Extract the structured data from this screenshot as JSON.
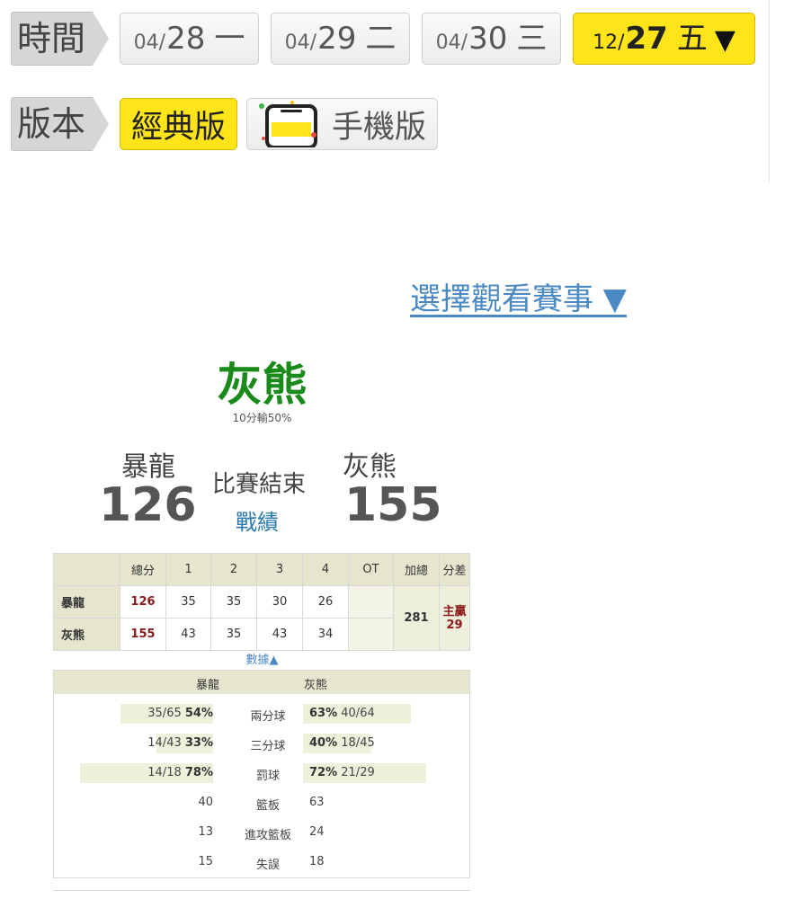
{
  "time_filter": {
    "label": "時間",
    "dates": [
      {
        "md": "04/",
        "d": "28",
        "w": "一",
        "active": false
      },
      {
        "md": "04/",
        "d": "29",
        "w": "二",
        "active": false
      },
      {
        "md": "04/",
        "d": "30",
        "w": "三",
        "active": false
      },
      {
        "md": "12/",
        "d": "27",
        "w": "五",
        "active": true,
        "arrow": "▼"
      }
    ]
  },
  "version_filter": {
    "label": "版本",
    "classic": "經典版",
    "mobile": "手機版"
  },
  "select_game": "選擇觀看賽事 ▼",
  "game": {
    "winner": "灰熊",
    "note": "10分輸50%",
    "away_name": "暴龍",
    "home_name": "灰熊",
    "away_score": "126",
    "home_score": "155",
    "status": "比賽結束",
    "record_link": "戰績"
  },
  "quarter_table": {
    "headers": [
      "",
      "總分",
      "1",
      "2",
      "3",
      "4",
      "OT",
      "加總",
      "分差"
    ],
    "rows": [
      {
        "team": "暴龍",
        "total": "126",
        "q1": "35",
        "q2": "35",
        "q3": "30",
        "q4": "26",
        "ot": ""
      },
      {
        "team": "灰熊",
        "total": "155",
        "q1": "43",
        "q2": "35",
        "q3": "43",
        "q4": "34",
        "ot": ""
      }
    ],
    "sum": "281",
    "diff_label": "主贏",
    "diff_value": "29"
  },
  "data_toggle": "數據▲",
  "stats": {
    "away_header": "暴龍",
    "home_header": "灰熊",
    "rows": [
      {
        "label": "兩分球",
        "away_frac": "35/65",
        "away_pct": "54%",
        "home_pct": "63%",
        "home_frac": "40/64",
        "away_level": 0.54,
        "home_level": 0.63
      },
      {
        "label": "三分球",
        "away_frac": "14/43",
        "away_pct": "33%",
        "home_pct": "40%",
        "home_frac": "18/45",
        "away_level": 0.33,
        "home_level": 0.4
      },
      {
        "label": "罰球",
        "away_frac": "14/18",
        "away_pct": "78%",
        "home_pct": "72%",
        "home_frac": "21/29",
        "away_level": 0.78,
        "home_level": 0.72
      },
      {
        "label": "籃板",
        "away_val": "40",
        "home_val": "63"
      },
      {
        "label": "進攻籃板",
        "away_val": "13",
        "home_val": "24"
      },
      {
        "label": "失誤",
        "away_val": "15",
        "home_val": "18"
      }
    ]
  }
}
